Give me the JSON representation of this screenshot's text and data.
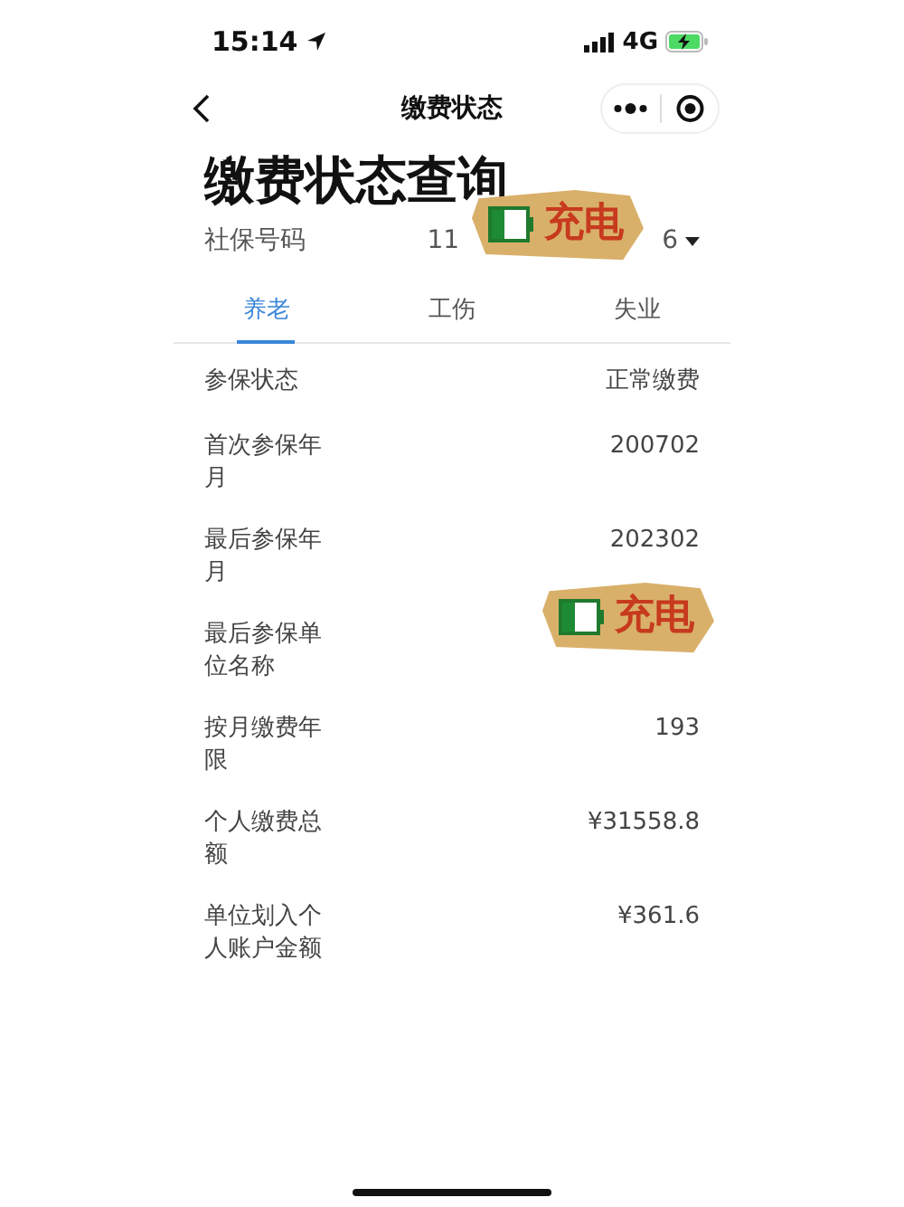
{
  "status_bar": {
    "time": "15:14",
    "network": "4G"
  },
  "nav": {
    "title": "缴费状态"
  },
  "heading": "缴费状态查询",
  "ssn": {
    "label": "社保号码",
    "value_start": "11",
    "value_end": "6",
    "sticker": {
      "text": "充电"
    }
  },
  "tabs": [
    {
      "label": "养老",
      "selected": true
    },
    {
      "label": "工伤",
      "selected": false
    },
    {
      "label": "失业",
      "selected": false
    }
  ],
  "rows": [
    {
      "label": "参保状态",
      "value": "正常缴费"
    },
    {
      "label": "首次参保年月",
      "value": "200702"
    },
    {
      "label": "最后参保年月",
      "value": "202302"
    },
    {
      "label": "最后参保单位名称",
      "sticker": {
        "text": "充电"
      }
    },
    {
      "label": "按月缴费年限",
      "value": "193"
    },
    {
      "label": "个人缴费总额",
      "value": "¥31558.8"
    },
    {
      "label": "单位划入个人账户金额",
      "value": "¥361.6"
    }
  ]
}
